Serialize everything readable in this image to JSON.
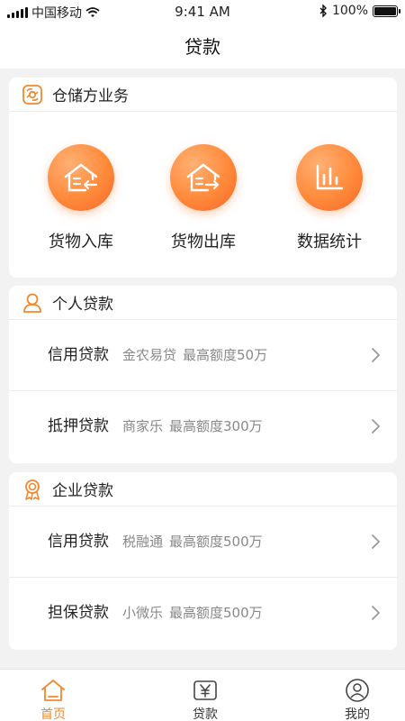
{
  "status_bar": {
    "carrier": "中国移动",
    "time": "9:41 AM",
    "battery": "100%",
    "battery_level": 1.0
  },
  "nav": {
    "title": "贷款"
  },
  "warehouse": {
    "title": "仓储方业务",
    "items": [
      {
        "label": "货物入库",
        "icon": "warehouse-in-icon"
      },
      {
        "label": "货物出库",
        "icon": "warehouse-out-icon"
      },
      {
        "label": "数据统计",
        "icon": "bar-chart-icon"
      }
    ]
  },
  "personal": {
    "title": "个人贷款",
    "rows": [
      {
        "name": "信用贷款",
        "product": "金农易贷",
        "limit": "最高额度50万"
      },
      {
        "name": "抵押贷款",
        "product": "商家乐",
        "limit": "最高额度300万"
      }
    ]
  },
  "enterprise": {
    "title": "企业贷款",
    "rows": [
      {
        "name": "信用贷款",
        "product": "税融通",
        "limit": "最高额度500万"
      },
      {
        "name": "担保贷款",
        "product": "小微乐",
        "limit": "最高额度500万"
      }
    ]
  },
  "tabbar": {
    "tabs": [
      {
        "label": "首页",
        "icon": "home-icon",
        "active": true
      },
      {
        "label": "贷款",
        "icon": "yen-icon",
        "active": false
      },
      {
        "label": "我的",
        "icon": "user-icon",
        "active": false
      }
    ]
  },
  "colors": {
    "accent": "#f5872c",
    "orange_gradient_start": "#ffb074",
    "orange_gradient_end": "#f7652a"
  }
}
